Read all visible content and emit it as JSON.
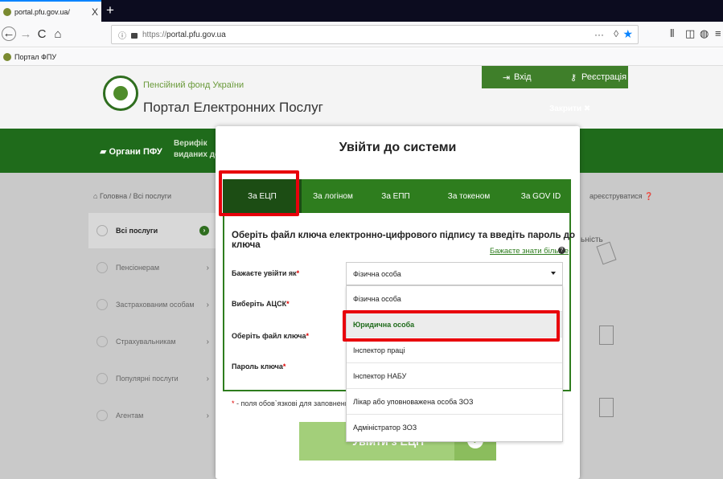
{
  "browser": {
    "tab_title": "portal.pfu.gov.ua/",
    "tab_close": "X",
    "new_tab": "+",
    "back": "←",
    "forward": "→",
    "reload": "C",
    "home": "⌂",
    "url_protocol": "https://",
    "url_host": "portal.pfu.gov.ua",
    "url_more": "···",
    "bookmark_label": "Портал ФПУ"
  },
  "site": {
    "org_name": "Пенсійний фонд України",
    "portal_title": "Портал Електронних Послуг",
    "login_link": "Вхід",
    "register_link": "Реєстрація",
    "close_label": "Закрити ✖",
    "nav_organs": "Органи ПФУ",
    "nav_verify": "Верифік\nвиданих до",
    "breadcrumb": "Головна / Всі послуги",
    "register_hint": "ареєструватися",
    "card_text": "ьність"
  },
  "sidebar": {
    "items": [
      {
        "label": "Всі послуги",
        "active": true
      },
      {
        "label": "Пенсіонерам",
        "active": false
      },
      {
        "label": "Застрахованим особам",
        "active": false
      },
      {
        "label": "Страхувальникам",
        "active": false
      },
      {
        "label": "Популярні послуги",
        "active": false
      },
      {
        "label": "Агентам",
        "active": false
      }
    ]
  },
  "modal": {
    "title": "Увійти до системи",
    "tabs": [
      "За ЕЦП",
      "За логіном",
      "За ЕПП",
      "За токеном",
      "За GOV ID"
    ],
    "active_tab": 0,
    "instruction": "Оберіть файл ключа електронно-цифрового підпису та введіть пароль до ключа",
    "more_link": "Бажаєте знати більше",
    "fields": {
      "login_as": "Бажаєте увійти як",
      "acsk": "Виберіть АЦСК",
      "key_file": "Оберіть файл ключа",
      "key_password": "Пароль ключа"
    },
    "required_mark": "*",
    "select_value": "Фізична особа",
    "options": [
      "Фізична особа",
      "Юридична особа",
      "Інспектор праці",
      "Інспектор НАБУ",
      "Лікар або уповноважена особа ЗОЗ",
      "Адміністратор ЗОЗ"
    ],
    "highlighted_option": 1,
    "footnote": " - поля обов`язкові для заповнення",
    "submit": "Увійти з ЕЦП"
  },
  "colors": {
    "brand_green": "#2e7d1e",
    "dark_green": "#1c4d14",
    "annotation_red": "#e8000b"
  }
}
